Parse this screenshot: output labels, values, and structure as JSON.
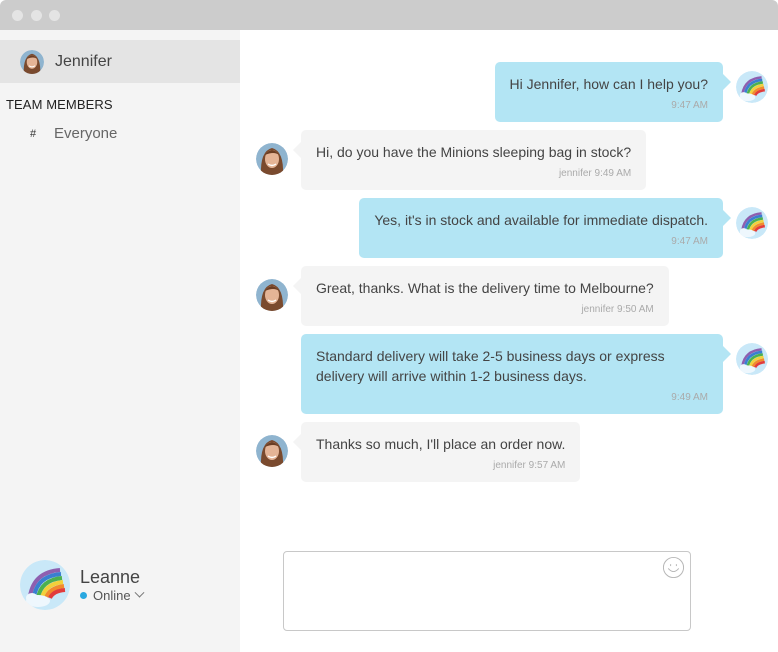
{
  "window": {
    "controls": [
      "close",
      "minimize",
      "maximize"
    ]
  },
  "sidebar": {
    "active_chat": {
      "name": "Jennifer",
      "avatar": "woman-photo-avatar"
    },
    "section_title": "TEAM MEMBERS",
    "channels": [
      {
        "prefix": "#",
        "label": "Everyone"
      }
    ],
    "current_user": {
      "name": "Leanne",
      "status": "Online",
      "avatar": "rainbow-avatar",
      "status_color": "#29a8e0"
    }
  },
  "messages": [
    {
      "direction": "out",
      "text": "Hi Jennifer, how can I help you?",
      "meta": "9:47 AM"
    },
    {
      "direction": "in",
      "text": "Hi, do you have the Minions sleeping bag in stock?",
      "meta": "jennifer 9:49 AM"
    },
    {
      "direction": "out",
      "text": "Yes, it's in stock and available for immediate dispatch.",
      "meta": "9:47 AM"
    },
    {
      "direction": "in",
      "text": "Great, thanks. What is the delivery time to Melbourne?",
      "meta": "jennifer 9:50 AM"
    },
    {
      "direction": "out",
      "text": "Standard delivery will take 2-5 business days or express delivery will arrive within 1-2 business days.",
      "meta": "9:49 AM"
    },
    {
      "direction": "in",
      "text": "Thanks so much, I'll place an order now.",
      "meta": "jennifer 9:57 AM"
    }
  ],
  "composer": {
    "value": "",
    "placeholder": "",
    "emoji_icon": "smiley-icon"
  },
  "colors": {
    "outgoing_bubble": "#b3e5f4",
    "incoming_bubble": "#f4f4f4",
    "sidebar_bg": "#f4f4f4",
    "titlebar": "#cccccc"
  }
}
